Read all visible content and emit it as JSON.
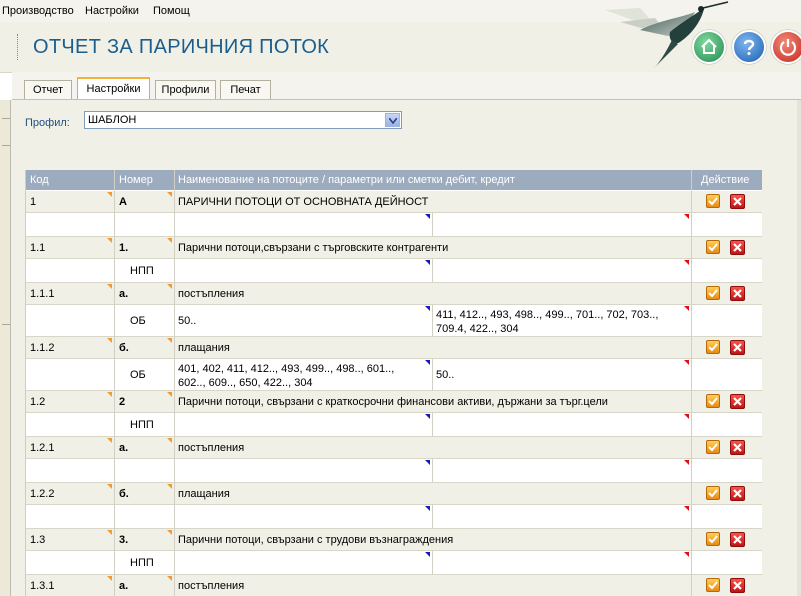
{
  "menu": [
    "Производство",
    "Настройки",
    "Помощ"
  ],
  "header": {
    "title": "ОТЧЕТ ЗА ПАРИЧНИЯ ПОТОК"
  },
  "tabs": [
    "Отчет",
    "Настройки",
    "Профили",
    "Печат"
  ],
  "active_tab": "Настройки",
  "profile": {
    "label": "Профил:",
    "value": "ШАБЛОН"
  },
  "table": {
    "headers": [
      "Код",
      "Номер",
      "Наименование на потоците / параметри или сметки дебит, кредит",
      "Действие"
    ],
    "rows": [
      {
        "kind": "level",
        "code": "1",
        "num": "А",
        "name": "ПАРИЧНИ ПОТОЦИ ОТ ОСНОВНАТА ДЕЙНОСТ"
      },
      {
        "kind": "param",
        "type": "",
        "debit": "",
        "credit": ""
      },
      {
        "kind": "level",
        "code": "1.1",
        "num": "1.",
        "name": "Парични потоци,свързани с търговските контрагенти"
      },
      {
        "kind": "param",
        "type": "НПП",
        "debit": "",
        "credit": ""
      },
      {
        "kind": "level",
        "code": "1.1.1",
        "num": "а.",
        "name": "постъпления"
      },
      {
        "kind": "param",
        "type": "ОБ",
        "debit": "50..",
        "credit": "411, 412.., 493, 498.., 499.., 701.., 702, 703.., 709.4, 422.., 304"
      },
      {
        "kind": "level",
        "code": "1.1.2",
        "num": "б.",
        "name": "плащания"
      },
      {
        "kind": "param",
        "type": "ОБ",
        "debit": "401, 402, 411, 412.., 493, 499.., 498.., 601.., 602.., 609.., 650, 422.., 304",
        "credit": "50.."
      },
      {
        "kind": "level",
        "code": "1.2",
        "num": "2",
        "name": "Парични потоци, свързани с краткосрочни финансови активи, държани за търг.цели"
      },
      {
        "kind": "param",
        "type": "НПП",
        "debit": "",
        "credit": ""
      },
      {
        "kind": "level",
        "code": "1.2.1",
        "num": "а.",
        "name": "постъпления"
      },
      {
        "kind": "param",
        "type": "",
        "debit": "",
        "credit": ""
      },
      {
        "kind": "level",
        "code": "1.2.2",
        "num": "б.",
        "name": "плащания"
      },
      {
        "kind": "param",
        "type": "",
        "debit": "",
        "credit": ""
      },
      {
        "kind": "level",
        "code": "1.3",
        "num": "3.",
        "name": "Парични потоци, свързани с трудови възнаграждения"
      },
      {
        "kind": "param",
        "type": "НПП",
        "debit": "",
        "credit": ""
      },
      {
        "kind": "level",
        "code": "1.3.1",
        "num": "а.",
        "name": "постъпления"
      }
    ]
  },
  "colors": {
    "title": "#1b5e8e",
    "header_bg": "#9cabbd",
    "accent_tab": "#f2b23c"
  }
}
